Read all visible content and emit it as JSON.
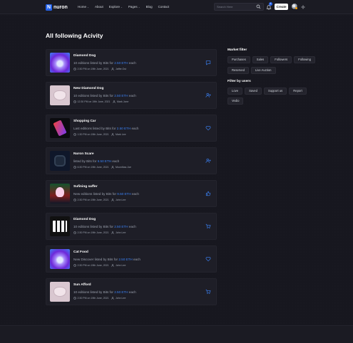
{
  "header": {
    "logo_mark": "N",
    "logo_text": "nuron",
    "nav": [
      {
        "label": "Home",
        "dropdown": true
      },
      {
        "label": "About",
        "dropdown": false
      },
      {
        "label": "Explore",
        "dropdown": true
      },
      {
        "label": "Pages",
        "dropdown": true
      },
      {
        "label": "Blog",
        "dropdown": false
      },
      {
        "label": "Contact",
        "dropdown": false
      }
    ],
    "search_placeholder": "Search Here",
    "notification_count": "6",
    "create_label": "Create"
  },
  "page_title": "All following Acivity",
  "activities": [
    {
      "title": "Diamond Dog",
      "desc_prefix": "10 editions listed by Bits for ",
      "price": "2.50 ETH",
      "desc_suffix": " each",
      "time": "2:30 PM on 19th June, 2021",
      "user": "Jaffer.Ost",
      "action_icon": "message-icon",
      "thumb": "purple"
    },
    {
      "title": "New Diamond Dog",
      "desc_prefix": "10 editions listed by Bits for ",
      "price": "2.50 ETH",
      "desc_suffix": " each",
      "time": "12:30 PM on 19th June, 2021",
      "user": "Mark Jone",
      "action_icon": "user-add-icon",
      "thumb": "mask"
    },
    {
      "title": "Shopping Car",
      "desc_prefix": "Last editions listed by Bits for ",
      "price": "2.50 ETH",
      "desc_suffix": " each",
      "time": "1:30 PM on 19th June, 2021",
      "user": "Mark Lee",
      "action_icon": "heart-icon",
      "thumb": "phone"
    },
    {
      "title": "Nuron Scare",
      "desc_prefix": "listed by Bits for ",
      "price": "6.50 ETH",
      "desc_suffix": " each",
      "time": "6:30 PM on 19th June, 2021",
      "user": "Moonthas Joe",
      "action_icon": "user-add-icon",
      "thumb": "watch"
    },
    {
      "title": "Sufining saffer",
      "desc_prefix": "New editions listed by Bits for ",
      "price": "9.50 ETH",
      "desc_suffix": " each",
      "time": "2:30 PM on 19th June, 2021",
      "user": "John Lee",
      "action_icon": "thumbs-up-icon",
      "thumb": "girl"
    },
    {
      "title": "Diamond Dog",
      "desc_prefix": "10 editions listed by Bits for ",
      "price": "2.50 ETH",
      "desc_suffix": " each",
      "time": "2:30 PM on 19th June, 2021",
      "user": "John Lee",
      "action_icon": "cart-icon",
      "thumb": "cards"
    },
    {
      "title": "Cat Food",
      "desc_prefix": "New Discover listed by Bits for ",
      "price": "2.50 ETH",
      "desc_suffix": " each",
      "time": "2:30 PM on 19th June, 2021",
      "user": "John Lee",
      "action_icon": "heart-icon",
      "thumb": "purple"
    },
    {
      "title": "Sun Afford",
      "desc_prefix": "10 editions listed by Bits for ",
      "price": "2.50 ETH",
      "desc_suffix": " each",
      "time": "2:30 PM on 19th June, 2021",
      "user": "John Lee",
      "action_icon": "cart-icon",
      "thumb": "mask"
    }
  ],
  "market_filter": {
    "title": "Market filter",
    "row1": [
      "Purchases",
      "Sales",
      "Followers",
      "Following"
    ],
    "row2": [
      "Reserved",
      "Live Auction"
    ]
  },
  "user_filter": {
    "title": "Filter by users",
    "row1": [
      "Love",
      "Saved",
      "Support us",
      "Report"
    ],
    "row2": [
      "Vedio"
    ]
  },
  "colors": {
    "accent": "#2563eb",
    "price": "#3b82f6",
    "background": "#17171f",
    "card": "#1e1e27"
  }
}
